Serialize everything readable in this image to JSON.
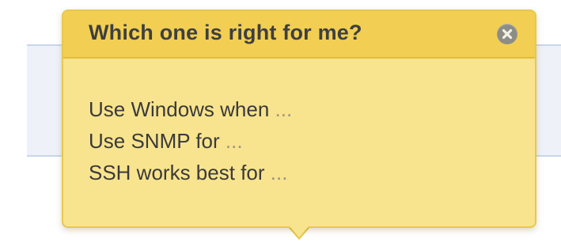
{
  "popover": {
    "title": "Which one is right for me?",
    "close_icon": "close-icon",
    "lines": [
      {
        "text": "Use Windows when",
        "ellipsis": "..."
      },
      {
        "text": "Use SNMP for",
        "ellipsis": "..."
      },
      {
        "text": "SSH works best for",
        "ellipsis": "..."
      }
    ]
  },
  "colors": {
    "popover_background": "#f8e48e",
    "header_background": "#f2cf52",
    "border": "#e8c84a",
    "close_button": "#8d8d88",
    "background_panel": "#eef2f8"
  }
}
